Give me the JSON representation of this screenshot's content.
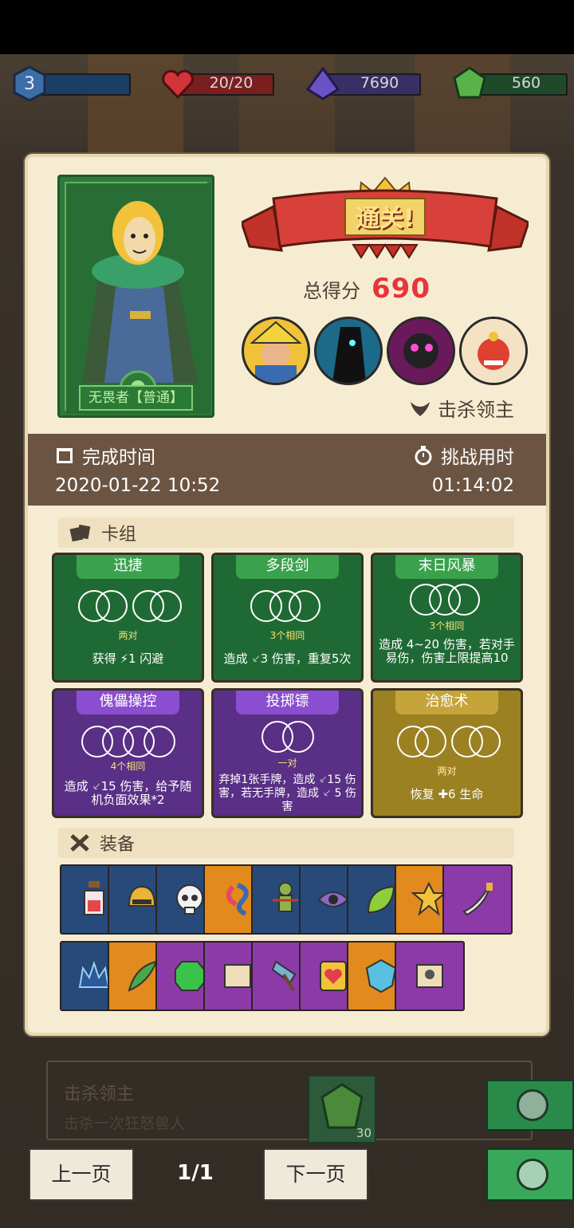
{
  "topbar": {
    "level": "3",
    "health": "20/20",
    "crystals": "7690",
    "gems": "560"
  },
  "result": {
    "banner": "通关!",
    "score_label": "总得分",
    "score_value": "690",
    "kill_boss_label": "击杀领主"
  },
  "hero": {
    "name": "无畏者【普通】"
  },
  "times": {
    "finish_label": "完成时间",
    "finish_value": "2020-01-22 10:52",
    "challenge_label": "挑战用时",
    "challenge_value": "01:14:02"
  },
  "deck": {
    "title": "卡组",
    "cards": [
      {
        "name": "迅捷",
        "tag": "两对",
        "desc": "获得 ⚡1 闪避",
        "color": "green"
      },
      {
        "name": "多段剑",
        "tag": "3个相同",
        "desc": "造成 ⸔3 伤害，重复5次",
        "color": "green"
      },
      {
        "name": "末日风暴",
        "tag": "3个相同",
        "desc": "造成 4~20 伤害，若对手 易伤，伤害上限提高10",
        "color": "green"
      },
      {
        "name": "傀儡操控",
        "tag": "4个相同",
        "desc": "造成 ⸔15 伤害，给予随机负面效果*2",
        "color": "purple"
      },
      {
        "name": "投掷镖",
        "tag": "一对",
        "desc": "弃掉1张手牌，造成 ⸔15 伤害，若无手牌，造成 ⸔ 5 伤害",
        "color": "purple"
      },
      {
        "name": "治愈术",
        "tag": "两对",
        "desc": "恢复 ✚6 生命",
        "color": "gold"
      }
    ]
  },
  "equipment": {
    "title": "装备",
    "row1": [
      "potion-icon",
      "helmet-icon",
      "skull-icon",
      "seal-icon",
      "voodoo-doll-icon",
      "eye-sigil-icon",
      "leaf-icon",
      "sun-badge-icon",
      "dagger-icon"
    ],
    "row2": [
      "crown-icon",
      "feather-icon",
      "emerald-icon",
      "scroll-icon",
      "axe-icon",
      "heart-card-icon",
      "crystal-shield-icon",
      "skull-scroll-icon"
    ]
  },
  "achievement": {
    "title": "击杀领主",
    "desc": "击杀一次狂怒兽人",
    "reward": "30"
  },
  "nav": {
    "prev": "上一页",
    "page": "1/1",
    "next": "下一页"
  }
}
